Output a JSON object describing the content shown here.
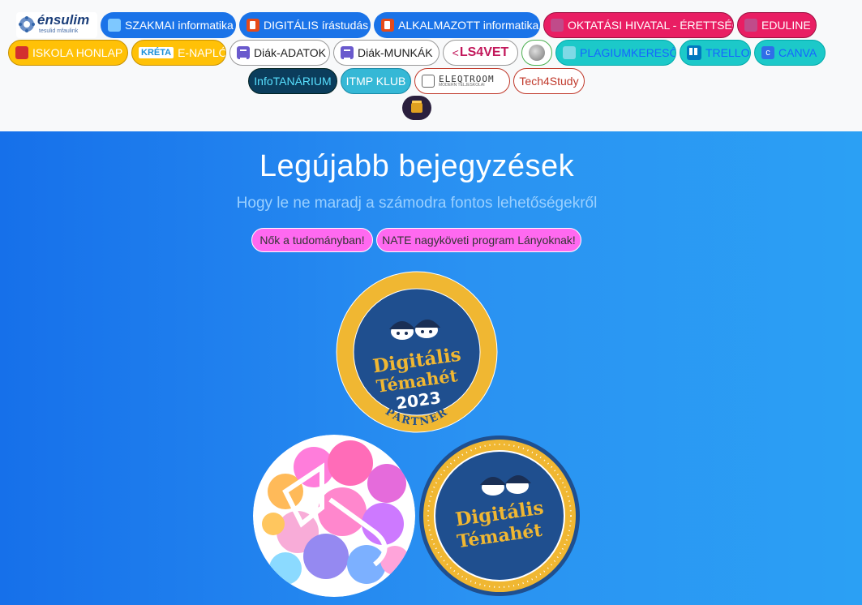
{
  "nav": {
    "logo_main": "énsulim",
    "logo_sub": "tesulid mfaulink",
    "buttons": [
      "SZAKMAI informatika",
      "DIGITÁLIS írástudás",
      "ALKALMAZOTT informatika",
      "OKTATÁSI HIVATAL - ÉRETTSÉGI",
      "EDULINE",
      "ISKOLA HONLAP",
      "E-NAPLÓ",
      "Diák-ADATOK",
      "Diák-MUNKÁK",
      "PLAGIUMKERESŐ",
      "TRELLO",
      "CANVA",
      "InfoTANÁRIUM",
      "ITMP KLUB",
      "Tech4Study"
    ],
    "logos": {
      "kreta": "KRÉTA",
      "ls4vet": "LS4VET",
      "eleqtroom": "ELEQTROOM",
      "eleqtroom_sub": "MODERN TELJESKOLAI",
      "canva_letter": "c"
    }
  },
  "hero": {
    "title": "Legújabb bejegyzések",
    "subtitle": "Hogy le ne maradj a számodra fontos lehetőségekről",
    "tags": [
      "Nők a tudományban!",
      "NATE nagyköveti program Lányoknak!"
    ]
  },
  "badges": {
    "partner": {
      "line1": "Digitális",
      "line2": "Témahét",
      "year": "2023",
      "ribbon": "PARTNER"
    },
    "small": {
      "line1": "Digitális",
      "line2": "Témahét"
    }
  },
  "colors": {
    "hero_start": "#1670ea",
    "hero_end": "#2ba0f4",
    "badge_gold": "#f0b732",
    "badge_navy": "#1f4f8f",
    "pink": "#ff69f0"
  }
}
